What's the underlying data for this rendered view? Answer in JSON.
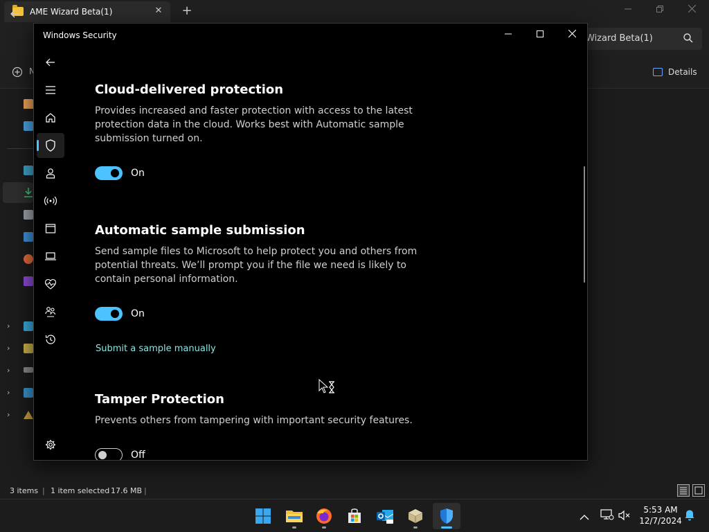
{
  "explorer": {
    "tab_title": "AME Wizard Beta(1)",
    "tab_close": "✕",
    "new_tab": "+",
    "search_text": "Wizard Beta(1)",
    "new_label": "N",
    "details_label": "Details",
    "status": {
      "items": "3 items",
      "separator": "|",
      "selected": "1 item selected",
      "size": "17.6 MB"
    }
  },
  "security": {
    "window_title": "Windows Security",
    "sections": [
      {
        "heading": "Cloud-delivered protection",
        "description": "Provides increased and faster protection with access to the latest protection data in the cloud. Works best with Automatic sample submission turned on.",
        "toggle_label": "On",
        "toggle_on": true
      },
      {
        "heading": "Automatic sample submission",
        "description": "Send sample files to Microsoft to help protect you and others from potential threats. We’ll prompt you if the file we need is likely to contain personal information.",
        "toggle_label": "On",
        "toggle_on": true
      },
      {
        "heading": "Tamper Protection",
        "description": "Prevents others from tampering with important security features.",
        "toggle_label": "Off",
        "toggle_on": false
      }
    ],
    "link_submit": "Submit a sample manually",
    "sidebar": [
      "back-arrow-icon",
      "hamburger-menu-icon",
      "home-icon",
      "shield-icon",
      "person-icon",
      "wifi-antenna-icon",
      "app-browser-icon",
      "laptop-icon",
      "heart-pulse-icon",
      "family-icon",
      "history-icon",
      "settings-gear-icon"
    ],
    "accent_color": "#4cc2ff",
    "link_color": "#8fe3e0"
  },
  "taskbar": {
    "time": "5:53 AM",
    "date": "12/7/2024",
    "apps": [
      "windows-start-icon",
      "file-explorer-icon",
      "firefox-icon",
      "microsoft-store-icon",
      "outlook-new-icon",
      "package-box-icon",
      "windows-security-icon"
    ]
  }
}
